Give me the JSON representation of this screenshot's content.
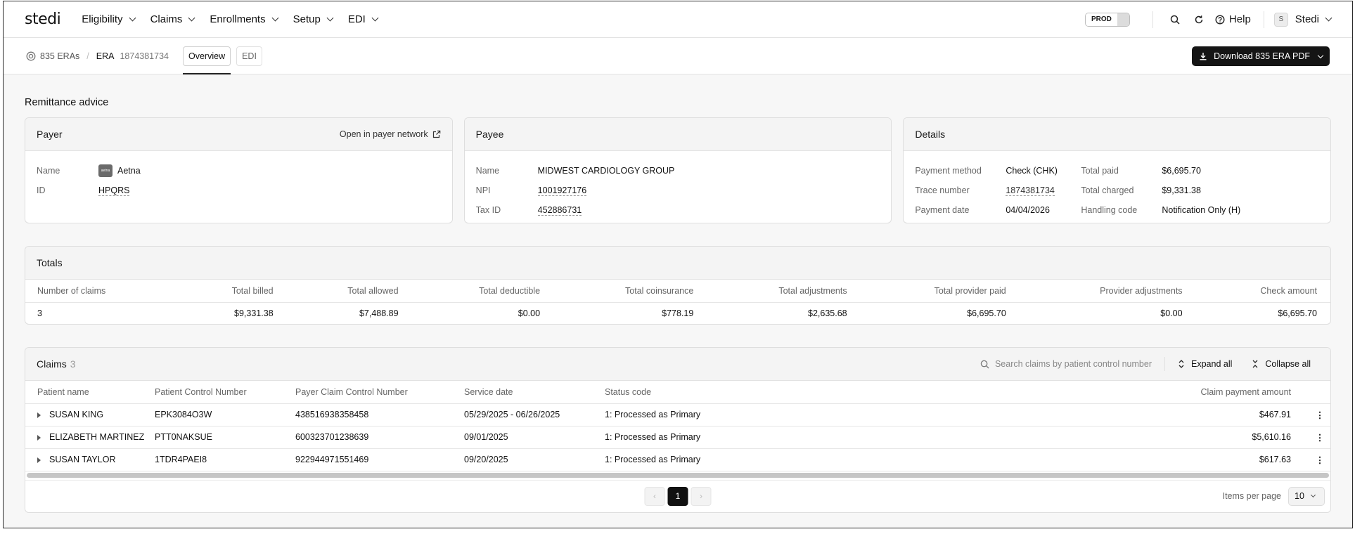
{
  "nav": {
    "logo": "stedi",
    "items": [
      {
        "label": "Eligibility"
      },
      {
        "label": "Claims"
      },
      {
        "label": "Enrollments"
      },
      {
        "label": "Setup"
      },
      {
        "label": "EDI"
      }
    ],
    "env_label": "PROD",
    "help_label": "Help",
    "user_initial": "S",
    "user_name": "Stedi",
    "icons": [
      "search-icon",
      "refresh-icon",
      "help-icon"
    ]
  },
  "subbar": {
    "breadcrumb_root": "835 ERAs",
    "breadcrumb_sep": "/",
    "era_label": "ERA",
    "era_id": "1874381734",
    "tabs": [
      {
        "label": "Overview",
        "active": true
      },
      {
        "label": "EDI",
        "active": false
      }
    ],
    "download_label": "Download 835 ERA PDF"
  },
  "section_title": "Remittance advice",
  "payer": {
    "title": "Payer",
    "link_label": "Open in payer network",
    "name_key": "Name",
    "name_value": "Aetna",
    "logo_text": "aetna",
    "id_key": "ID",
    "id_value": "HPQRS"
  },
  "payee": {
    "title": "Payee",
    "name_key": "Name",
    "name_value": "MIDWEST CARDIOLOGY GROUP",
    "npi_key": "NPI",
    "npi_value": "1001927176",
    "tax_key": "Tax ID",
    "tax_value": "452886731"
  },
  "details": {
    "title": "Details",
    "payment_method_key": "Payment method",
    "payment_method_value": "Check (CHK)",
    "trace_key": "Trace number",
    "trace_value": "1874381734",
    "payment_date_key": "Payment date",
    "payment_date_value": "04/04/2026",
    "total_paid_key": "Total paid",
    "total_paid_value": "$6,695.70",
    "total_charged_key": "Total charged",
    "total_charged_value": "$9,331.38",
    "handling_key": "Handling code",
    "handling_value": "Notification Only (H)"
  },
  "totals": {
    "title": "Totals",
    "headers": [
      "Number of claims",
      "Total billed",
      "Total allowed",
      "Total deductible",
      "Total coinsurance",
      "Total adjustments",
      "Total provider paid",
      "Provider adjustments",
      "Check amount"
    ],
    "values": [
      "3",
      "$9,331.38",
      "$7,488.89",
      "$0.00",
      "$778.19",
      "$2,635.68",
      "$6,695.70",
      "$0.00",
      "$6,695.70"
    ]
  },
  "claims": {
    "title": "Claims",
    "count": "3",
    "search_placeholder": "Search claims by patient control number",
    "expand_label": "Expand all",
    "collapse_label": "Collapse all",
    "headers": [
      "Patient name",
      "Patient Control Number",
      "Payer Claim Control Number",
      "Service date",
      "Status code",
      "Claim payment amount"
    ],
    "rows": [
      {
        "name": "SUSAN KING",
        "pcn": "EPK3084O3W",
        "payer_ccn": "438516938358458",
        "service_date": "05/29/2025 - 06/26/2025",
        "status": "1: Processed as Primary",
        "amount": "$467.91"
      },
      {
        "name": "ELIZABETH MARTINEZ",
        "pcn": "PTT0NAKSUE",
        "payer_ccn": "600323701238639",
        "service_date": "09/01/2025",
        "status": "1: Processed as Primary",
        "amount": "$5,610.16"
      },
      {
        "name": "SUSAN TAYLOR",
        "pcn": "1TDR4PAEI8",
        "payer_ccn": "922944971551469",
        "service_date": "09/20/2025",
        "status": "1: Processed as Primary",
        "amount": "$617.63"
      }
    ],
    "pager": {
      "prev": "‹",
      "current": "1",
      "next": "›"
    },
    "items_per_page_label": "Items per page",
    "items_per_page_value": "10"
  }
}
